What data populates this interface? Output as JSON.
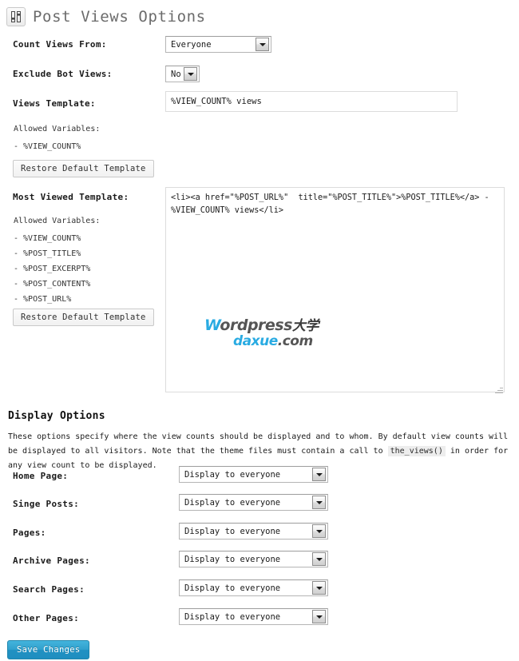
{
  "header": {
    "title": "Post Views Options",
    "icon": "sliders-icon"
  },
  "settings": {
    "count_views_from": {
      "label": "Count Views From:",
      "value": "Everyone"
    },
    "exclude_bot_views": {
      "label": "Exclude Bot Views:",
      "value": "No"
    },
    "views_template": {
      "label": "Views Template:",
      "value": "%VIEW_COUNT% views"
    },
    "views_template_vars": {
      "heading": "Allowed Variables:",
      "items": [
        "- %VIEW_COUNT%"
      ]
    },
    "views_restore_button": "Restore Default Template",
    "most_viewed_template": {
      "label": "Most Viewed Template:",
      "value": "<li><a href=\"%POST_URL%\"  title=\"%POST_TITLE%\">%POST_TITLE%</a> - %VIEW_COUNT% views</li>"
    },
    "most_viewed_vars": {
      "heading": "Allowed Variables:",
      "items": [
        "- %VIEW_COUNT%",
        "- %POST_TITLE%",
        "- %POST_EXCERPT%",
        "- %POST_CONTENT%",
        "- %POST_URL%"
      ]
    },
    "most_viewed_restore_button": "Restore Default Template"
  },
  "watermark": {
    "line1_a": "W",
    "line1_b": "ordpress",
    "line1_cn": "大学",
    "line2_a": "daxue",
    "line2_b": ".com",
    "brand_color": "#29abe2"
  },
  "display_options": {
    "title": "Display Options",
    "desc_part1": "These options specify where the view counts should be displayed and to whom. By default view counts will be displayed to all visitors. Note that the theme files must contain a call to ",
    "desc_code": "the_views()",
    "desc_part2": " in order for any view count to be displayed.",
    "rows": [
      {
        "label": "Home Page:",
        "value": "Display to everyone"
      },
      {
        "label": "Singe Posts:",
        "value": "Display to everyone"
      },
      {
        "label": "Pages:",
        "value": "Display to everyone"
      },
      {
        "label": "Archive Pages:",
        "value": "Display to everyone"
      },
      {
        "label": "Search Pages:",
        "value": "Display to everyone"
      },
      {
        "label": "Other Pages:",
        "value": "Display to everyone"
      }
    ]
  },
  "footer": {
    "save_button": "Save Changes",
    "save_color": "#2f9fcc"
  }
}
